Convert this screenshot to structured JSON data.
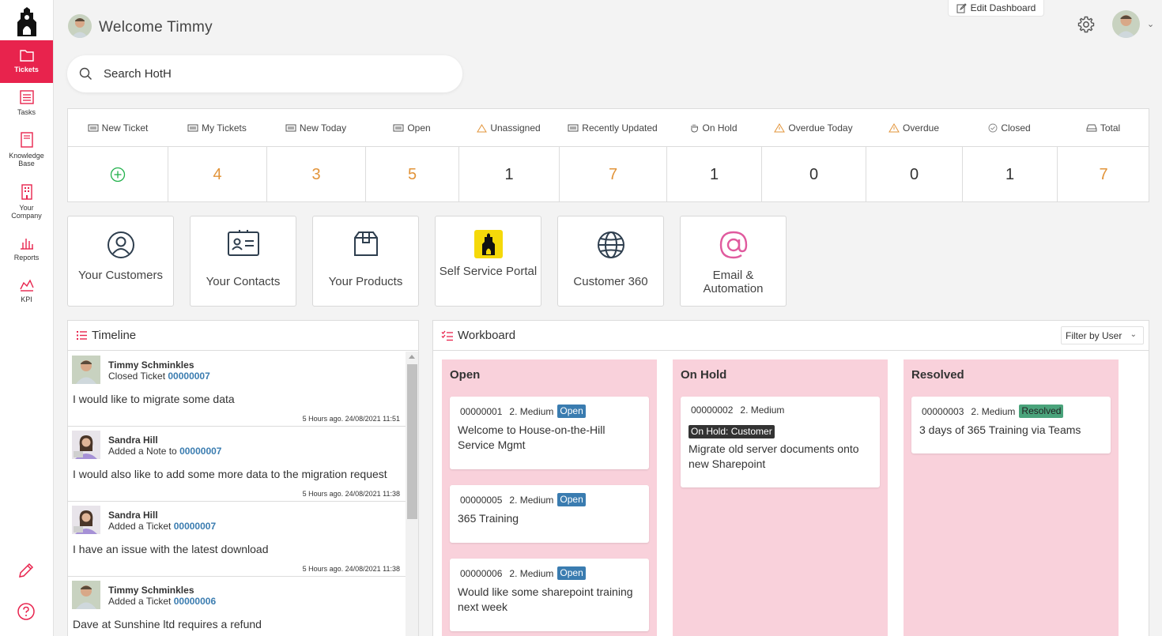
{
  "sidebar": {
    "items": [
      {
        "label": "Tickets",
        "icon": "folder-icon",
        "active": true
      },
      {
        "label": "Tasks",
        "icon": "list-icon"
      },
      {
        "label": "Knowledge Base",
        "icon": "book-icon"
      },
      {
        "label": "Your Company",
        "icon": "building-icon"
      },
      {
        "label": "Reports",
        "icon": "bar-chart-icon"
      },
      {
        "label": "KPI",
        "icon": "area-chart-icon"
      }
    ],
    "bottom_icons": [
      "pencil-icon",
      "help-icon"
    ]
  },
  "header": {
    "welcome": "Welcome Timmy",
    "edit_dashboard": "Edit Dashboard"
  },
  "search": {
    "placeholder": "Search HotH"
  },
  "stats": {
    "headers": [
      "New Ticket",
      "My Tickets",
      "New Today",
      "Open",
      "Unassigned",
      "Recently Updated",
      "On Hold",
      "Overdue Today",
      "Overdue",
      "Closed",
      "Total"
    ],
    "values": [
      "",
      "4",
      "3",
      "5",
      "1",
      "7",
      "1",
      "0",
      "0",
      "1",
      "7"
    ]
  },
  "tiles": [
    {
      "label": "Your Customers",
      "icon": "user-circle-icon"
    },
    {
      "label": "Your Contacts",
      "icon": "contact-card-icon"
    },
    {
      "label": "Your Products",
      "icon": "box-icon"
    },
    {
      "label": "Self Service Portal",
      "icon": "portal-logo-icon"
    },
    {
      "label": "Customer 360",
      "icon": "globe-icon"
    },
    {
      "label": "Email & Automation",
      "icon": "at-icon"
    }
  ],
  "timeline": {
    "title": "Timeline",
    "items": [
      {
        "name": "Timmy Schminkles",
        "action": "Closed Ticket",
        "ticket": "00000007",
        "text": "I would like to migrate some data",
        "time": "5 Hours ago. 24/08/2021 11:51"
      },
      {
        "name": "Sandra Hill",
        "action": "Added a Note to",
        "ticket": "00000007",
        "text": "I would also like to add some more data to the migration request",
        "time": "5 Hours ago. 24/08/2021 11:38"
      },
      {
        "name": "Sandra Hill",
        "action": "Added a Ticket",
        "ticket": "00000007",
        "text": "I have an issue with the latest download",
        "time": "5 Hours ago. 24/08/2021 11:38"
      },
      {
        "name": "Timmy Schminkles",
        "action": "Added a Ticket",
        "ticket": "00000006",
        "text": "Dave at Sunshine ltd requires a refund",
        "time": ""
      }
    ]
  },
  "workboard": {
    "title": "Workboard",
    "filter": "Filter by User",
    "columns": [
      {
        "title": "Open",
        "cards": [
          {
            "id": "00000001",
            "priority": "2. Medium",
            "status": "Open",
            "title": "Welcome to House-on-the-Hill Service Mgmt"
          },
          {
            "id": "00000005",
            "priority": "2. Medium",
            "status": "Open",
            "title": "365 Training"
          },
          {
            "id": "00000006",
            "priority": "2. Medium",
            "status": "Open",
            "title": "Would like some sharepoint training next week"
          }
        ]
      },
      {
        "title": "On Hold",
        "cards": [
          {
            "id": "00000002",
            "priority": "2. Medium",
            "status": "On Hold: Customer",
            "title": "Migrate old server documents onto new Sharepoint"
          }
        ]
      },
      {
        "title": "Resolved",
        "cards": [
          {
            "id": "00000003",
            "priority": "2. Medium",
            "status": "Resolved",
            "title": "3 days of 365 Training via Teams"
          }
        ]
      }
    ]
  },
  "colors": {
    "accent": "#e8234d",
    "stat_orange": "#e2943a",
    "link_blue": "#3a7cb0",
    "board_pink": "#f9d1db",
    "badge_open": "#3a7cb0",
    "badge_resolved": "#4aa37b"
  }
}
